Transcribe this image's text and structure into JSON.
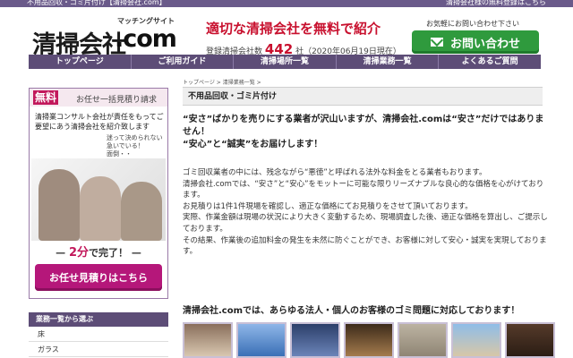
{
  "window": {
    "title_left": "不用品回収・ゴミ片付け【清掃会社.com】",
    "title_right": "清掃会社様の無料登録はこちら"
  },
  "header": {
    "logo_text": "清掃会社",
    "logo_sub": "マッチングサイト",
    "logo_com": ".com",
    "catch": "適切な清掃会社を無料で紹介",
    "reg_prefix": "登録清掃会社数",
    "reg_count": "442",
    "reg_suffix": "社（2020年06月19日現在）",
    "contact_note": "お気軽にお問い合わせ下さい",
    "contact_label": "お問い合わせ"
  },
  "nav": {
    "items": [
      "トップページ",
      "ご利用ガイド",
      "清掃場所一覧",
      "清掃業務一覧",
      "よくあるご質問"
    ]
  },
  "breadcrumb": "トップページ > 清掃業務一覧 >",
  "section_title": "不用品回収・ゴミ片付け",
  "sidebar": {
    "muryo": "無料",
    "omakase": "お任せ一括見積り請求",
    "desc": "清掃業コンサルト会社が責任をもってご要望にあう清掃会社を紹介致します",
    "hint": "迷って決められない\n急いでいる！\n面倒・・",
    "two_min_prefix": "— ",
    "two_min_red": "2分",
    "two_min_suffix": "で完了！ —",
    "cta": "お任せ見積りはこちら",
    "category_head": "業務一覧から選ぶ",
    "categories": [
      "床",
      "ガラス"
    ]
  },
  "main": {
    "lead": "“安さ”ばかりを売りにする業者が沢山いますが、清掃会社.comは“安さ”だけではありません！\n“安心”と“誠実”をお届けします！",
    "body": "ゴミ回収業者の中には、残念ながら“悪徳”と呼ばれる法外な料金をとる業者もおります。\n清掃会社.comでは、“安さ”と“安心”をモットーに可能な限りリーズナブルな良心的な価格を心がけております。\nお見積りは1件1件現場を確認し、適正な価格にてお見積りをさせて頂いております。\n実際、作業金額は現場の状況により大きく変動するため、現場調査した後、適正な価格を算出し、ご提示しております。\nその結果、作業後の追加料金の発生を未然に防ぐことができ、お客様に対して安心・誠実を実現しております。",
    "bottom_title": "清掃会社.comでは、あらゆる法人・個人のお客様のゴミ問題に対応しております！"
  },
  "colors": {
    "nav": "#5d4d77",
    "accent_red": "#c8102e",
    "contact_green": "#2f9a3d",
    "cta_magenta": "#b5177a"
  }
}
